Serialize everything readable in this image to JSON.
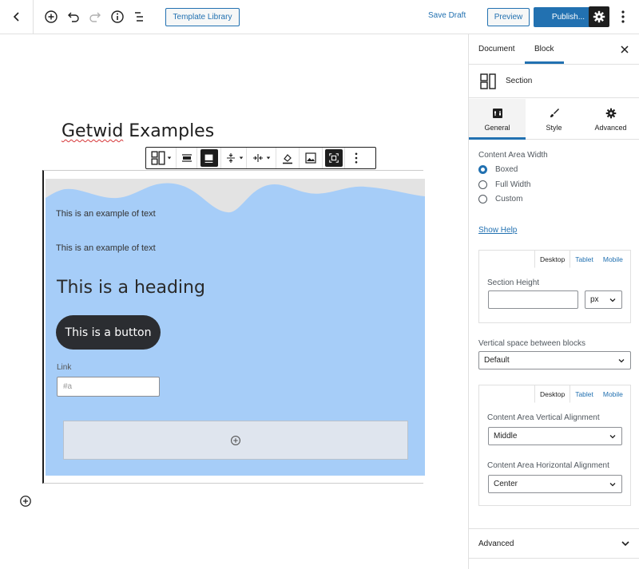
{
  "topbar": {
    "template_library": "Template Library",
    "save_draft": "Save Draft",
    "preview": "Preview",
    "publish": "Publish..."
  },
  "editor": {
    "post_title_word1": "Getwid",
    "post_title_word2": " Examples",
    "section": {
      "text1": "This is an example of text",
      "text2": "This is an example of text",
      "heading": "This is a heading",
      "button": "This is a button",
      "link_label": "Link",
      "link_placeholder": "#a"
    }
  },
  "sidebar": {
    "tabs": [
      "Document",
      "Block"
    ],
    "active_tab": "Block",
    "block_name": "Section",
    "panel_tabs": [
      "General",
      "Style",
      "Advanced"
    ],
    "active_panel_tab": "General",
    "content_area_width": {
      "label": "Content Area Width",
      "options": [
        "Boxed",
        "Full Width",
        "Custom"
      ],
      "selected": "Boxed"
    },
    "show_help": "Show Help",
    "responsive_tabs": [
      "Desktop",
      "Tablet",
      "Mobile"
    ],
    "section_height": {
      "label": "Section Height",
      "value": "",
      "unit": "px"
    },
    "vertical_space": {
      "label": "Vertical space between blocks",
      "value": "Default"
    },
    "vertical_alignment": {
      "label": "Content Area Vertical Alignment",
      "value": "Middle"
    },
    "horizontal_alignment": {
      "label": "Content Area Horizontal Alignment",
      "value": "Center"
    },
    "advanced_panel": "Advanced"
  },
  "colors": {
    "accent": "#2271b1",
    "section_background": "#a6cdf8",
    "wave": "#e3e3e3",
    "dark_button": "#2b2d31"
  }
}
